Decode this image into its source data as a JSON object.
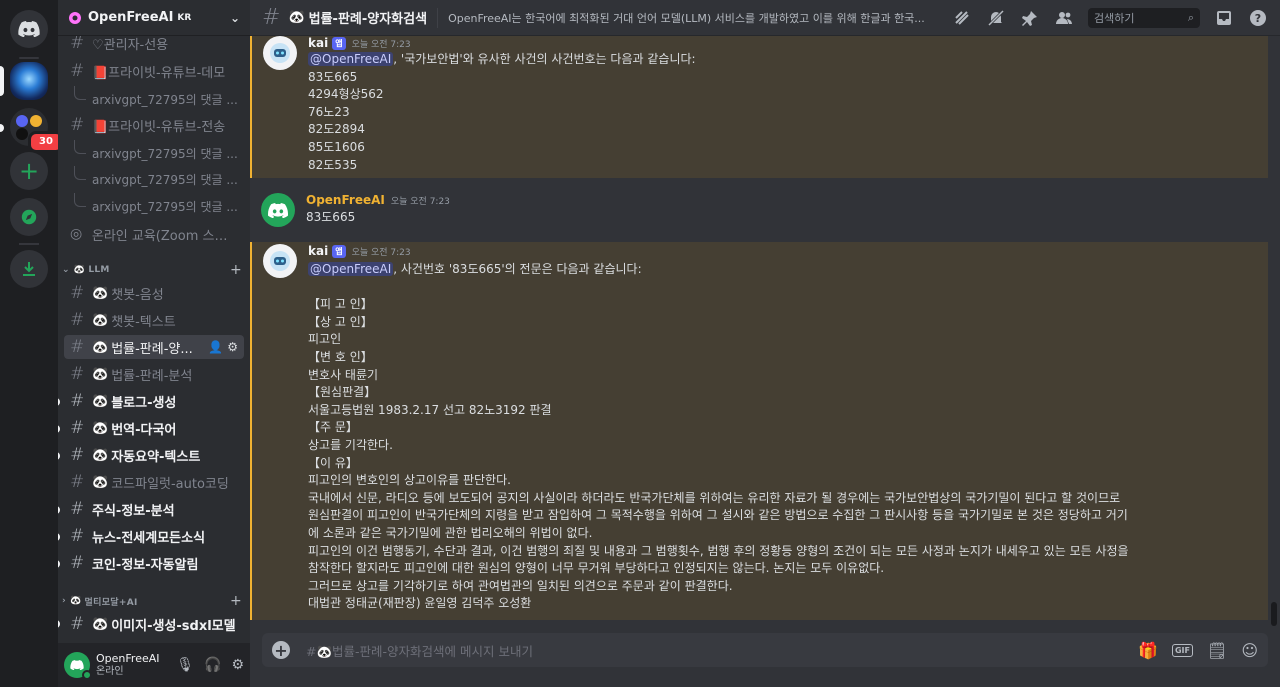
{
  "server": {
    "name": "OpenFreeAI",
    "name_suffix": "KR",
    "badge_count": "30"
  },
  "sidebar": {
    "channels": [
      {
        "label": "♡관리자-선용",
        "type": "channel",
        "unread": false
      },
      {
        "label": "📕프라이빗-유튜브-데모",
        "type": "channel",
        "unread": false
      },
      {
        "label": "arxivgpt_72795의 댓글 ...",
        "type": "thread"
      },
      {
        "label": "📕프라이빗-유튜브-전송",
        "type": "channel",
        "unread": false
      },
      {
        "label": "arxivgpt_72795의 댓글 ...",
        "type": "thread"
      },
      {
        "label": "arxivgpt_72795의 댓글 ...",
        "type": "thread"
      },
      {
        "label": "arxivgpt_72795의 댓글 ...",
        "type": "thread"
      },
      {
        "label": "온라인 교육(Zoom 스타...",
        "type": "stage"
      }
    ],
    "category_llm": "LLM",
    "llm_channels": [
      {
        "label": "챗봇-음성",
        "unread": false,
        "selected": false
      },
      {
        "label": "챗봇-텍스트",
        "unread": false,
        "selected": false
      },
      {
        "label": "법률-판례-양...",
        "unread": false,
        "selected": true
      },
      {
        "label": "법률-판례-분석",
        "unread": false,
        "selected": false
      },
      {
        "label": "블로그-생성",
        "unread": true,
        "selected": false
      },
      {
        "label": "번역-다국어",
        "unread": true,
        "selected": false
      },
      {
        "label": "자동요약-텍스트",
        "unread": true,
        "selected": false
      },
      {
        "label": "코드파일럿-auto코딩",
        "unread": false,
        "selected": false
      },
      {
        "label": "주식-정보-분석",
        "unread": true,
        "selected": false
      },
      {
        "label": "뉴스-전세계모든소식",
        "unread": true,
        "selected": false
      },
      {
        "label": "코인-정보-자동알림",
        "unread": true,
        "selected": false
      }
    ],
    "category_multi": "멀티모달+AI",
    "multi_channels": [
      {
        "label": "이미지-생성-sdxl모델",
        "unread": true
      }
    ]
  },
  "user": {
    "name": "OpenFreeAI",
    "status": "온라인"
  },
  "header": {
    "channel_name": "법률-판례-양자화검색",
    "topic": "OpenFreeAI는 한국어에 최적화된 거대 언어 모델(LLM) 서비스를 개발하였고 이를 위해 한글과 한국...",
    "search_placeholder": "검색하기"
  },
  "messages": [
    {
      "author": "kai",
      "tag": "앱",
      "time": "오늘 오전 7:23",
      "mention": "@OpenFreeAI",
      "first_line_rest": ", '국가보안법'와 유사한 사건의 사건번호는 다음과 같습니다:",
      "lines": [
        "83도665",
        "4294형상562",
        "76노23",
        "82도2894",
        "85도1606",
        "82도535"
      ]
    },
    {
      "author": "OpenFreeAI",
      "time": "오늘 오전 7:23",
      "lines": [
        "83도665"
      ]
    },
    {
      "author": "kai",
      "tag": "앱",
      "time": "오늘 오전 7:23",
      "mention": "@OpenFreeAI",
      "first_line_rest": ", 사건번호 '83도665'의 전문은 다음과 같습니다:",
      "lines": [
        "",
        "【피 고 인】",
        "【상 고 인】",
        "피고인",
        "【변 호 인】",
        "변호사 태륜기",
        "【원심판결】",
        "서울고등법원 1983.2.17 선고 82노3192 판결",
        "【주 문】",
        "상고를 기각한다.",
        "【이 유】",
        "피고인의 변호인의 상고이유를 판단한다.",
        "국내에서 신문, 라디오 등에 보도되어 공지의 사실이라 하더라도 반국가단체를 위하여는 유리한 자료가 될 경우에는 국가보안법상의 국가기밀이 된다고 할 것이므로",
        "원심판결이 피고인이 반국가단체의 지령을 받고 잠입하여 그 목적수행을 위하여 그 설시와 같은 방법으로 수집한 그 판시사항 등을 국가기밀로 본 것은 정당하고 거기",
        "에 소론과 같은 국가기밀에 관한 법리오해의 위법이 없다.",
        "피고인의 이건 범행동기, 수단과 결과, 이건 범행의 죄질 및 내용과 그 범행횟수, 범행 후의 정황등 양형의 조건이 되는 모든 사정과 논지가 내세우고 있는 모든 사정을",
        "참작한다 할지라도 피고인에 대한 원심의 양형이 너무 무거워 부당하다고 인정되지는 않는다. 논지는 모두 이유없다.",
        "그러므로 상고를 기각하기로 하여 관여법관의 일치된 의견으로 주문과 같이 판결한다.",
        "대법관 정태균(재판장) 윤일영 김덕주 오성환"
      ]
    }
  ],
  "composer": {
    "placeholder": "#🐼법률-판례-양자화검색에 메시지 보내기"
  }
}
